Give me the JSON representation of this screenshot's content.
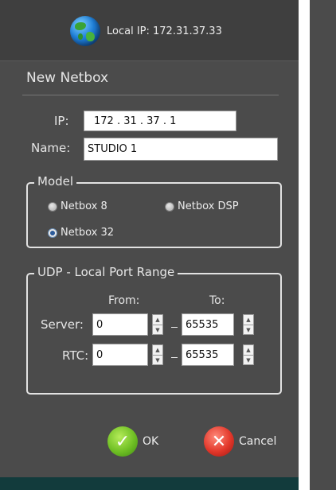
{
  "header": {
    "local_ip_label": "Local IP: 172.31.37.33",
    "icon": "globe-icon"
  },
  "dialog": {
    "title": "New  Netbox",
    "ip_label": "IP:",
    "ip_value": "172 . 31 . 37 . 1",
    "name_label": "Name:",
    "name_value": "STUDIO 1"
  },
  "model": {
    "legend": "Model",
    "options": [
      {
        "label": "Netbox 8",
        "checked": false
      },
      {
        "label": "Netbox DSP",
        "checked": false
      },
      {
        "label": "Netbox 32",
        "checked": true
      }
    ]
  },
  "udp": {
    "legend": "UDP - Local Port Range",
    "from_label": "From:",
    "to_label": "To:",
    "server_label": "Server:",
    "server_from": "0",
    "server_to": "65535",
    "rtc_label": "RTC:",
    "rtc_from": "0",
    "rtc_to": "65535"
  },
  "buttons": {
    "ok_label": "OK",
    "cancel_label": "Cancel"
  },
  "colors": {
    "panel": "#4b4b4b",
    "header": "#3f3f3f",
    "footer": "#123b3c",
    "ok": "#6fbf24",
    "cancel": "#e2372a"
  }
}
